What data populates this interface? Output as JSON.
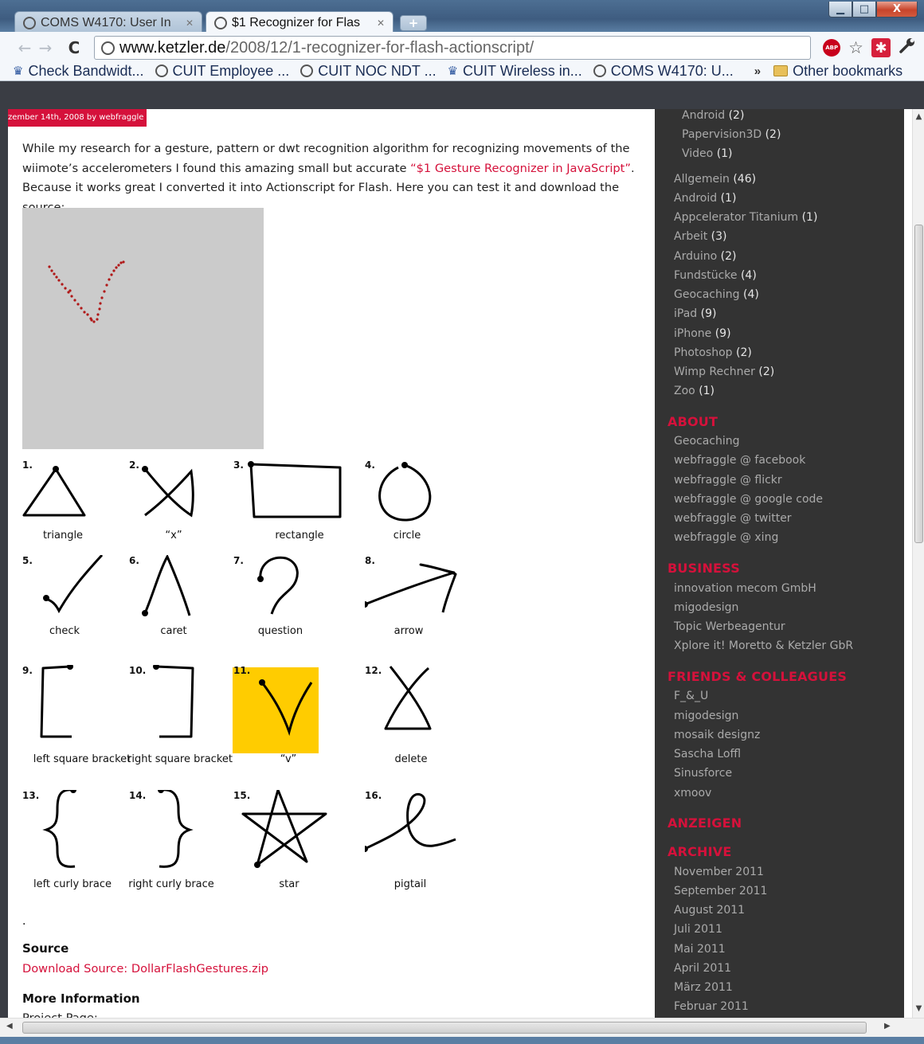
{
  "window": {
    "min_glyph": "▁",
    "max_glyph": "□",
    "close_glyph": "X"
  },
  "tabs": [
    {
      "title": "COMS W4170: User In",
      "state": "inactive"
    },
    {
      "title": "$1 Recognizer for Flas",
      "state": "active"
    }
  ],
  "new_tab_glyph": "+",
  "omnibox": {
    "domain": "www.ketzler.de",
    "path": "/2008/12/1-recognizer-for-flash-actionscript/"
  },
  "toolbar_icons": {
    "back": "←",
    "forward": "→",
    "reload": "C",
    "adblock": "ABP",
    "bookmark_star": "☆",
    "extension": "✱",
    "wrench": "🔧"
  },
  "bookmarks": [
    {
      "label": "Check Bandwidt...",
      "icon": "crown-icon"
    },
    {
      "label": "CUIT Employee ...",
      "icon": "globe-icon"
    },
    {
      "label": "CUIT NOC NDT ...",
      "icon": "globe-icon"
    },
    {
      "label": "CUIT Wireless in...",
      "icon": "crown-icon"
    },
    {
      "label": "COMS W4170: U...",
      "icon": "globe-icon"
    }
  ],
  "bookmarks_more": "»",
  "other_bookmarks": "Other bookmarks",
  "post": {
    "date_badge": "zember 14th, 2008 by webfraggle",
    "intro_1": "While my research for a gesture, pattern or dwt recognition algorithm for recognizing movements of the wiimote’s accelerometers I found this amazing small but accurate ",
    "intro_link": "“$1 Gesture Recognizer in JavaScript”",
    "intro_2": ". Because it works great I converted it into Actionscript for Flash. Here you can test it and download the source:",
    "gestures": [
      {
        "num": "1.",
        "label": "triangle"
      },
      {
        "num": "2.",
        "label": "“x”"
      },
      {
        "num": "3.",
        "label": "rectangle"
      },
      {
        "num": "4.",
        "label": "circle"
      },
      {
        "num": "5.",
        "label": "check"
      },
      {
        "num": "6.",
        "label": "caret"
      },
      {
        "num": "7.",
        "label": "question"
      },
      {
        "num": "8.",
        "label": "arrow"
      },
      {
        "num": "9.",
        "label": "left square bracket"
      },
      {
        "num": "10.",
        "label": "right square bracket"
      },
      {
        "num": "11.",
        "label": "“v”"
      },
      {
        "num": "12.",
        "label": "delete"
      },
      {
        "num": "13.",
        "label": "left curly brace"
      },
      {
        "num": "14.",
        "label": "right curly brace"
      },
      {
        "num": "15.",
        "label": "star"
      },
      {
        "num": "16.",
        "label": "pigtail"
      }
    ],
    "period": ".",
    "source_heading": "Source",
    "download_link": "Download Source: DollarFlashGestures.zip",
    "more_heading": "More Information",
    "project_page": "Project Page:"
  },
  "sidebar": {
    "sub_categories": [
      {
        "label": "Android",
        "count": "(2)"
      },
      {
        "label": "Papervision3D",
        "count": "(2)"
      },
      {
        "label": "Video",
        "count": "(1)"
      }
    ],
    "categories": [
      {
        "label": "Allgemein",
        "count": "(46)"
      },
      {
        "label": "Android",
        "count": "(1)"
      },
      {
        "label": "Appcelerator Titanium",
        "count": "(1)"
      },
      {
        "label": "Arbeit",
        "count": "(3)"
      },
      {
        "label": "Arduino",
        "count": "(2)"
      },
      {
        "label": "Fundstücke",
        "count": "(4)"
      },
      {
        "label": "Geocaching",
        "count": "(4)"
      },
      {
        "label": "iPad",
        "count": "(9)"
      },
      {
        "label": "iPhone",
        "count": "(9)"
      },
      {
        "label": "Photoshop",
        "count": "(2)"
      },
      {
        "label": "Wimp Rechner",
        "count": "(2)"
      },
      {
        "label": "Zoo",
        "count": "(1)"
      }
    ],
    "about_heading": "ABOUT",
    "about": [
      "Geocaching",
      "webfraggle @ facebook",
      "webfraggle @ flickr",
      "webfraggle @ google code",
      "webfraggle @ twitter",
      "webfraggle @ xing"
    ],
    "business_heading": "BUSINESS",
    "business": [
      "innovation mecom GmbH",
      "migodesign",
      "Topic Werbeagentur",
      "Xplore it! Moretto & Ketzler GbR"
    ],
    "friends_heading": "FRIENDS & COLLEAGUES",
    "friends": [
      "F_&_U",
      "migodesign",
      "mosaik designz",
      "Sascha Loffl",
      "Sinusforce",
      "xmoov"
    ],
    "ads_heading": "ANZEIGEN",
    "archive_heading": "ARCHIVE",
    "archive": [
      "November 2011",
      "September 2011",
      "August 2011",
      "Juli 2011",
      "Mai 2011",
      "April 2011",
      "März 2011",
      "Februar 2011"
    ]
  },
  "colors": {
    "accent": "#d5113b",
    "sidebar_bg": "#333333",
    "highlight": "#ffcc00",
    "canvas_bg": "#cbcbcb",
    "stroke": "#b01818"
  }
}
